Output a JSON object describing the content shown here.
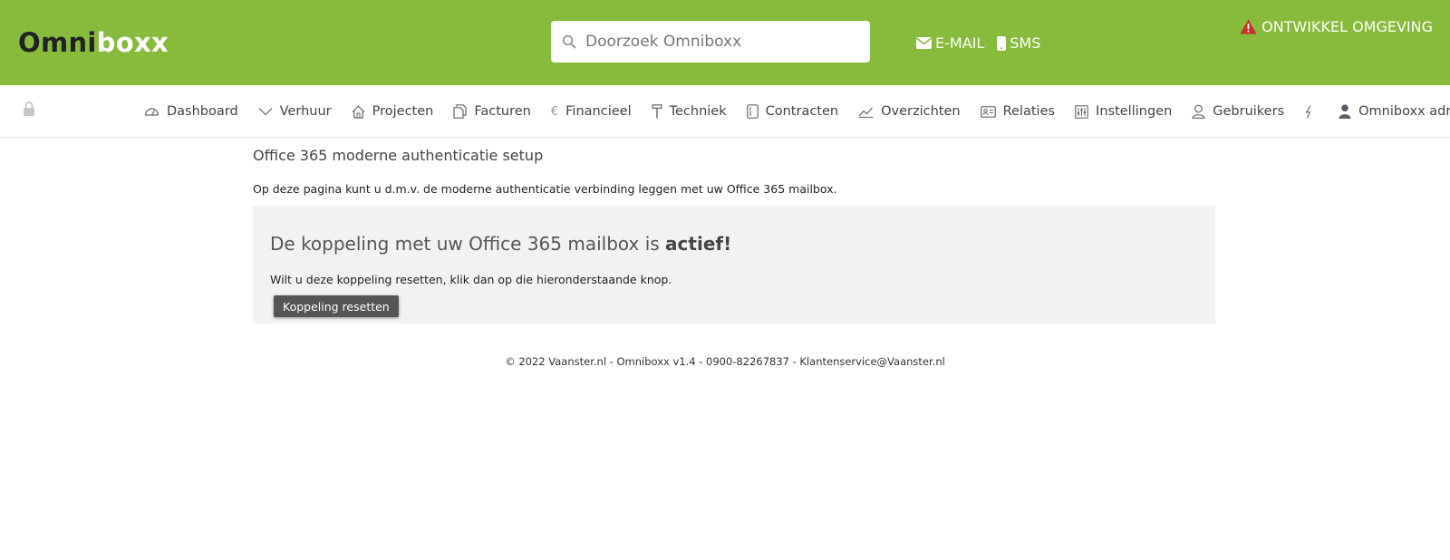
{
  "header": {
    "logo_part1": "Omni",
    "logo_part2": "boxx",
    "search_placeholder": "Doorzoek Omniboxx",
    "email_label": "E-MAIL",
    "sms_label": "SMS",
    "environment_label": "ONTWIKKEL OMGEVING",
    "brand_color": "#86bb3c",
    "warning_color": "#c9302c"
  },
  "nav": {
    "items": [
      {
        "label": "Dashboard",
        "icon": "dashboard-icon"
      },
      {
        "label": "Verhuur",
        "icon": "chevron-down-icon"
      },
      {
        "label": "Projecten",
        "icon": "home-icon"
      },
      {
        "label": "Facturen",
        "icon": "documents-icon"
      },
      {
        "label": "Financieel",
        "icon": "euro-icon"
      },
      {
        "label": "Techniek",
        "icon": "hammer-icon"
      },
      {
        "label": "Contracten",
        "icon": "contract-icon"
      },
      {
        "label": "Overzichten",
        "icon": "chart-icon"
      },
      {
        "label": "Relaties",
        "icon": "id-card-icon"
      },
      {
        "label": "Instellingen",
        "icon": "sliders-icon"
      },
      {
        "label": "Gebruikers",
        "icon": "user-icon"
      }
    ],
    "user_label": "Omniboxx admin"
  },
  "main": {
    "title": "Office 365 moderne authenticatie setup",
    "intro": "Op deze pagina kunt u d.m.v. de moderne authenticatie verbinding leggen met uw Office 365 mailbox.",
    "status_text": "De koppeling met uw Office 365 mailbox is",
    "status_value": "actief!",
    "reset_text": "Wilt u deze koppeling resetten, klik dan op die hieronderstaande knop.",
    "reset_button": "Koppeling resetten"
  },
  "footer": {
    "text": "© 2022 Vaanster.nl - Omniboxx v1.4 - 0900-82267837 - Klantenservice@Vaanster.nl"
  }
}
